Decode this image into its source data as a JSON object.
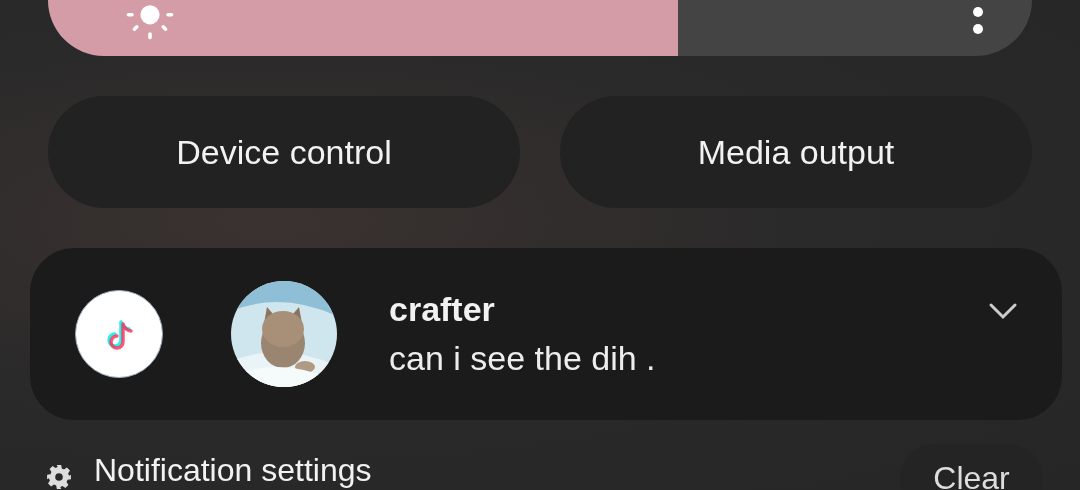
{
  "brightness": {
    "level": 0.64
  },
  "buttons": [
    {
      "label": "Device control"
    },
    {
      "label": "Media output"
    }
  ],
  "notification": {
    "title": "crafter",
    "message": "can i see the dih .",
    "expanded": false
  },
  "footer": {
    "settings_label": "Notification settings",
    "clear_label": "Clear"
  }
}
